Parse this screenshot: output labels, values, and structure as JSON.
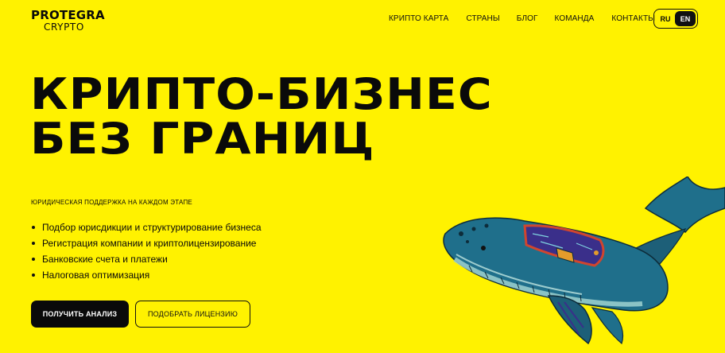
{
  "brand": {
    "name": "PROTEGRA",
    "sub": "CRYPTO"
  },
  "nav": {
    "items": [
      "КРИПТО КАРТА",
      "СТРАНЫ",
      "БЛОГ",
      "КОМАНДА",
      "КОНТАКТЫ"
    ]
  },
  "lang": {
    "ru": "RU",
    "en": "EN",
    "active": "EN"
  },
  "hero": {
    "title_line1": "КРИПТО-БИЗНЕС",
    "title_line2": "БЕЗ ГРАНИЦ",
    "subtitle": "ЮРИДИЧЕСКАЯ ПОДДЕРЖКА НА КАЖДОМ ЭТАПЕ",
    "features": [
      "Подбор юрисдикции и структурирование бизнеса",
      "Регистрация компании и криптолицензирование",
      "Банковские счета и платежи",
      "Налоговая оптимизация"
    ],
    "primary_button": "ПОЛУЧИТЬ АНАЛИЗ",
    "secondary_button": "ПОДОБРАТЬ ЛИЦЕНЗИЮ"
  },
  "colors": {
    "background": "#FFF200",
    "text": "#0a0a0a",
    "whale_body": "#1f6f8b",
    "whale_accent": "#d1452e",
    "whale_plate": "#3a2f8a"
  },
  "illustration": {
    "icon": "whale-illustration"
  }
}
